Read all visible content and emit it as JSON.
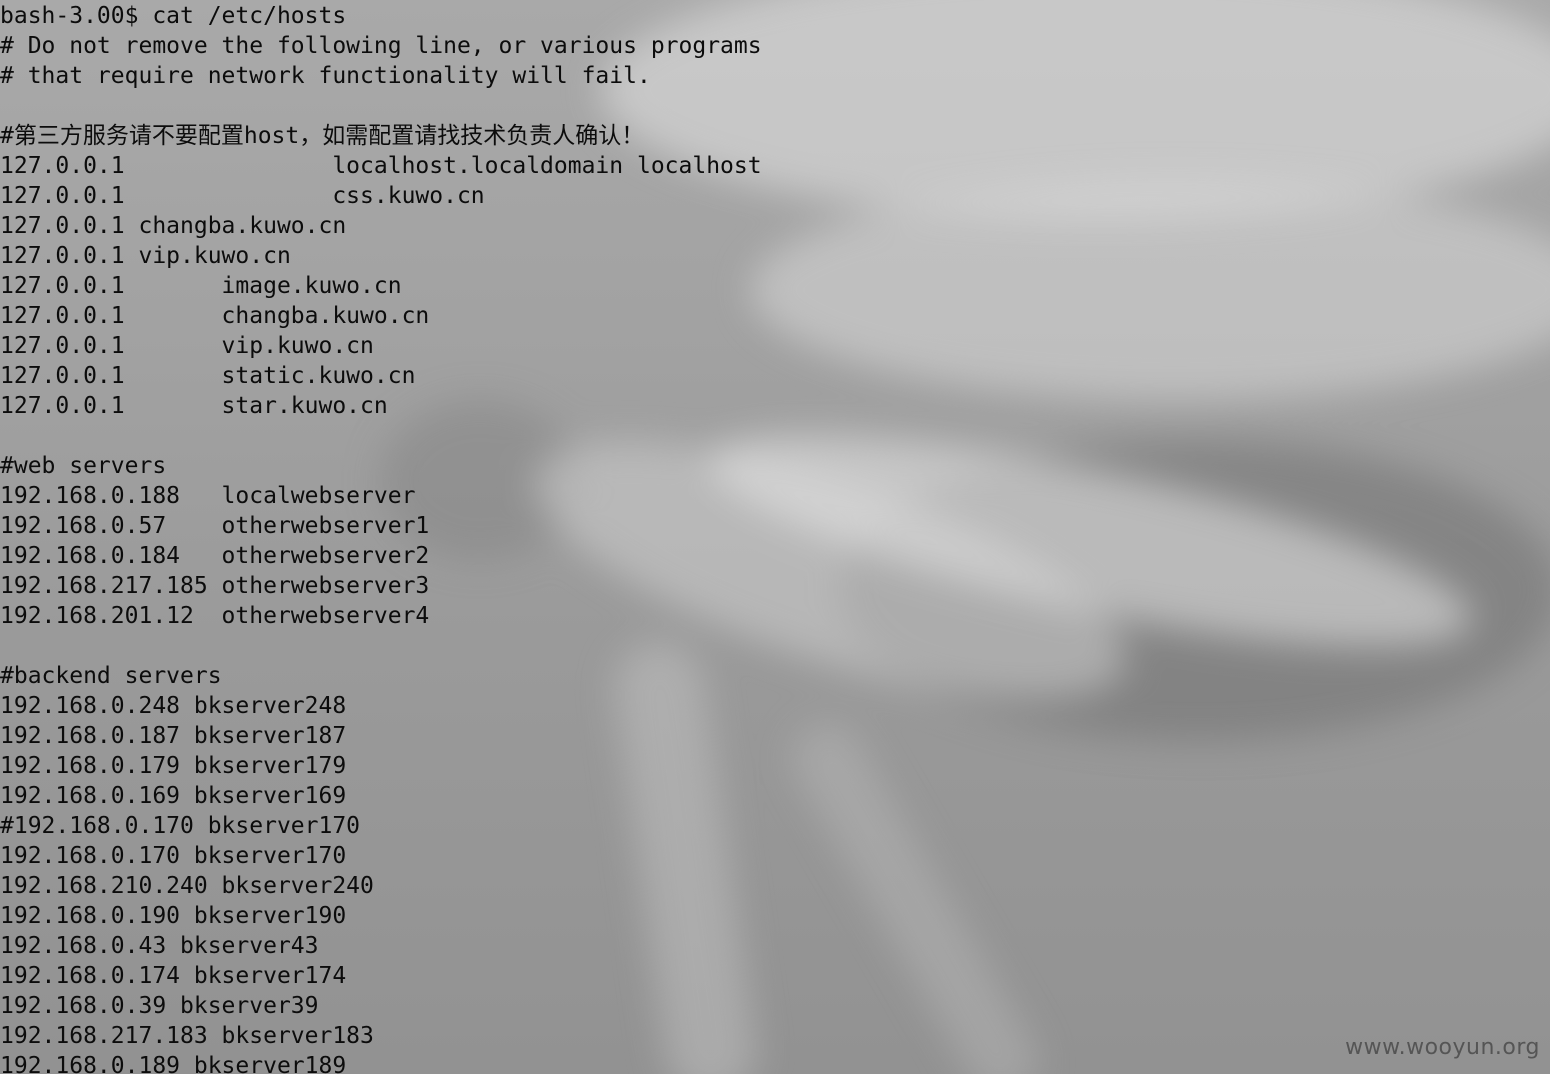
{
  "terminal": {
    "lines": [
      "bash-3.00$ cat /etc/hosts",
      "# Do not remove the following line, or various programs",
      "# that require network functionality will fail.",
      "",
      "#第三方服务请不要配置host，如需配置请找技术负责人确认！",
      "127.0.0.1               localhost.localdomain localhost",
      "127.0.0.1               css.kuwo.cn",
      "127.0.0.1 changba.kuwo.cn",
      "127.0.0.1 vip.kuwo.cn",
      "127.0.0.1       image.kuwo.cn",
      "127.0.0.1       changba.kuwo.cn",
      "127.0.0.1       vip.kuwo.cn",
      "127.0.0.1       static.kuwo.cn",
      "127.0.0.1       star.kuwo.cn",
      "",
      "#web servers",
      "192.168.0.188   localwebserver",
      "192.168.0.57    otherwebserver1",
      "192.168.0.184   otherwebserver2",
      "192.168.217.185 otherwebserver3",
      "192.168.201.12  otherwebserver4",
      "",
      "#backend servers",
      "192.168.0.248 bkserver248",
      "192.168.0.187 bkserver187",
      "192.168.0.179 bkserver179",
      "192.168.0.169 bkserver169",
      "#192.168.0.170 bkserver170",
      "192.168.0.170 bkserver170",
      "192.168.210.240 bkserver240",
      "192.168.0.190 bkserver190",
      "192.168.0.43 bkserver43",
      "192.168.0.174 bkserver174",
      "192.168.0.39 bkserver39",
      "192.168.217.183 bkserver183",
      "192.168.0.189 bkserver189"
    ]
  },
  "watermark": "www.wooyun.org",
  "colors": {
    "text": "#0c0c0c",
    "background": "#a0a0a0",
    "watermark": "#555555"
  }
}
